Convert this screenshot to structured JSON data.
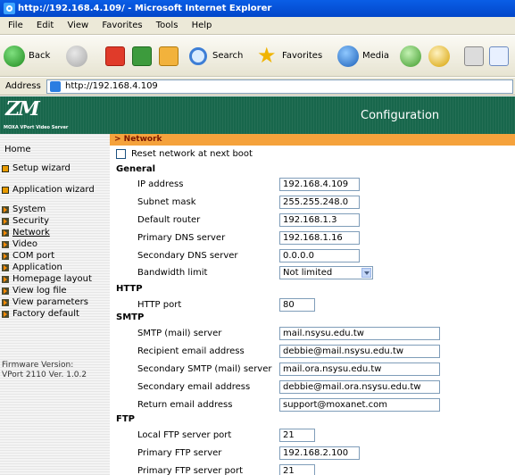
{
  "window": {
    "title": "http://192.168.4.109/ - Microsoft Internet Explorer"
  },
  "menu": [
    "File",
    "Edit",
    "View",
    "Favorites",
    "Tools",
    "Help"
  ],
  "toolbar": {
    "back": "Back",
    "search": "Search",
    "favorites": "Favorites",
    "media": "Media"
  },
  "address": {
    "label": "Address",
    "url": "http://192.168.4.109"
  },
  "banner": {
    "logo": "ZM",
    "subtitle": "MOXA VPort Video Server",
    "title": "Configuration"
  },
  "sidebar": {
    "home": "Home",
    "setup_wizard": "Setup wizard",
    "application_wizard": "Application wizard",
    "items": [
      "System",
      "Security",
      "Network",
      "Video",
      "COM port",
      "Application",
      "Homepage layout",
      "View log file",
      "View parameters",
      "Factory default"
    ],
    "firmware_line1": "Firmware Version:",
    "firmware_line2": "VPort 2110 Ver. 1.0.2"
  },
  "content": {
    "section": "> Network",
    "reset_label": "Reset network at next boot",
    "general": {
      "title": "General",
      "ip_label": "IP address",
      "ip": "192.168.4.109",
      "subnet_label": "Subnet mask",
      "subnet": "255.255.248.0",
      "router_label": "Default router",
      "router": "192.168.1.3",
      "dns1_label": "Primary DNS server",
      "dns1": "192.168.1.16",
      "dns2_label": "Secondary DNS server",
      "dns2": "0.0.0.0",
      "bandwidth_label": "Bandwidth limit",
      "bandwidth": "Not limited"
    },
    "http": {
      "title": "HTTP",
      "port_label": "HTTP port",
      "port": "80"
    },
    "smtp": {
      "title": "SMTP",
      "server_label": "SMTP (mail) server",
      "server": "mail.nsysu.edu.tw",
      "recipient_label": "Recipient email address",
      "recipient": "debbie@mail.nsysu.edu.tw",
      "server2_label": "Secondary SMTP (mail) server",
      "server2": "mail.ora.nsysu.edu.tw",
      "email2_label": "Secondary email address",
      "email2": "debbie@mail.ora.nsysu.edu.tw",
      "return_label": "Return email address",
      "return": "support@moxanet.com"
    },
    "ftp": {
      "title": "FTP",
      "local_port_label": "Local FTP server port",
      "local_port": "21",
      "server_label": "Primary FTP server",
      "server": "192.168.2.100",
      "server_port_label": "Primary FTP server port",
      "server_port": "21"
    }
  }
}
